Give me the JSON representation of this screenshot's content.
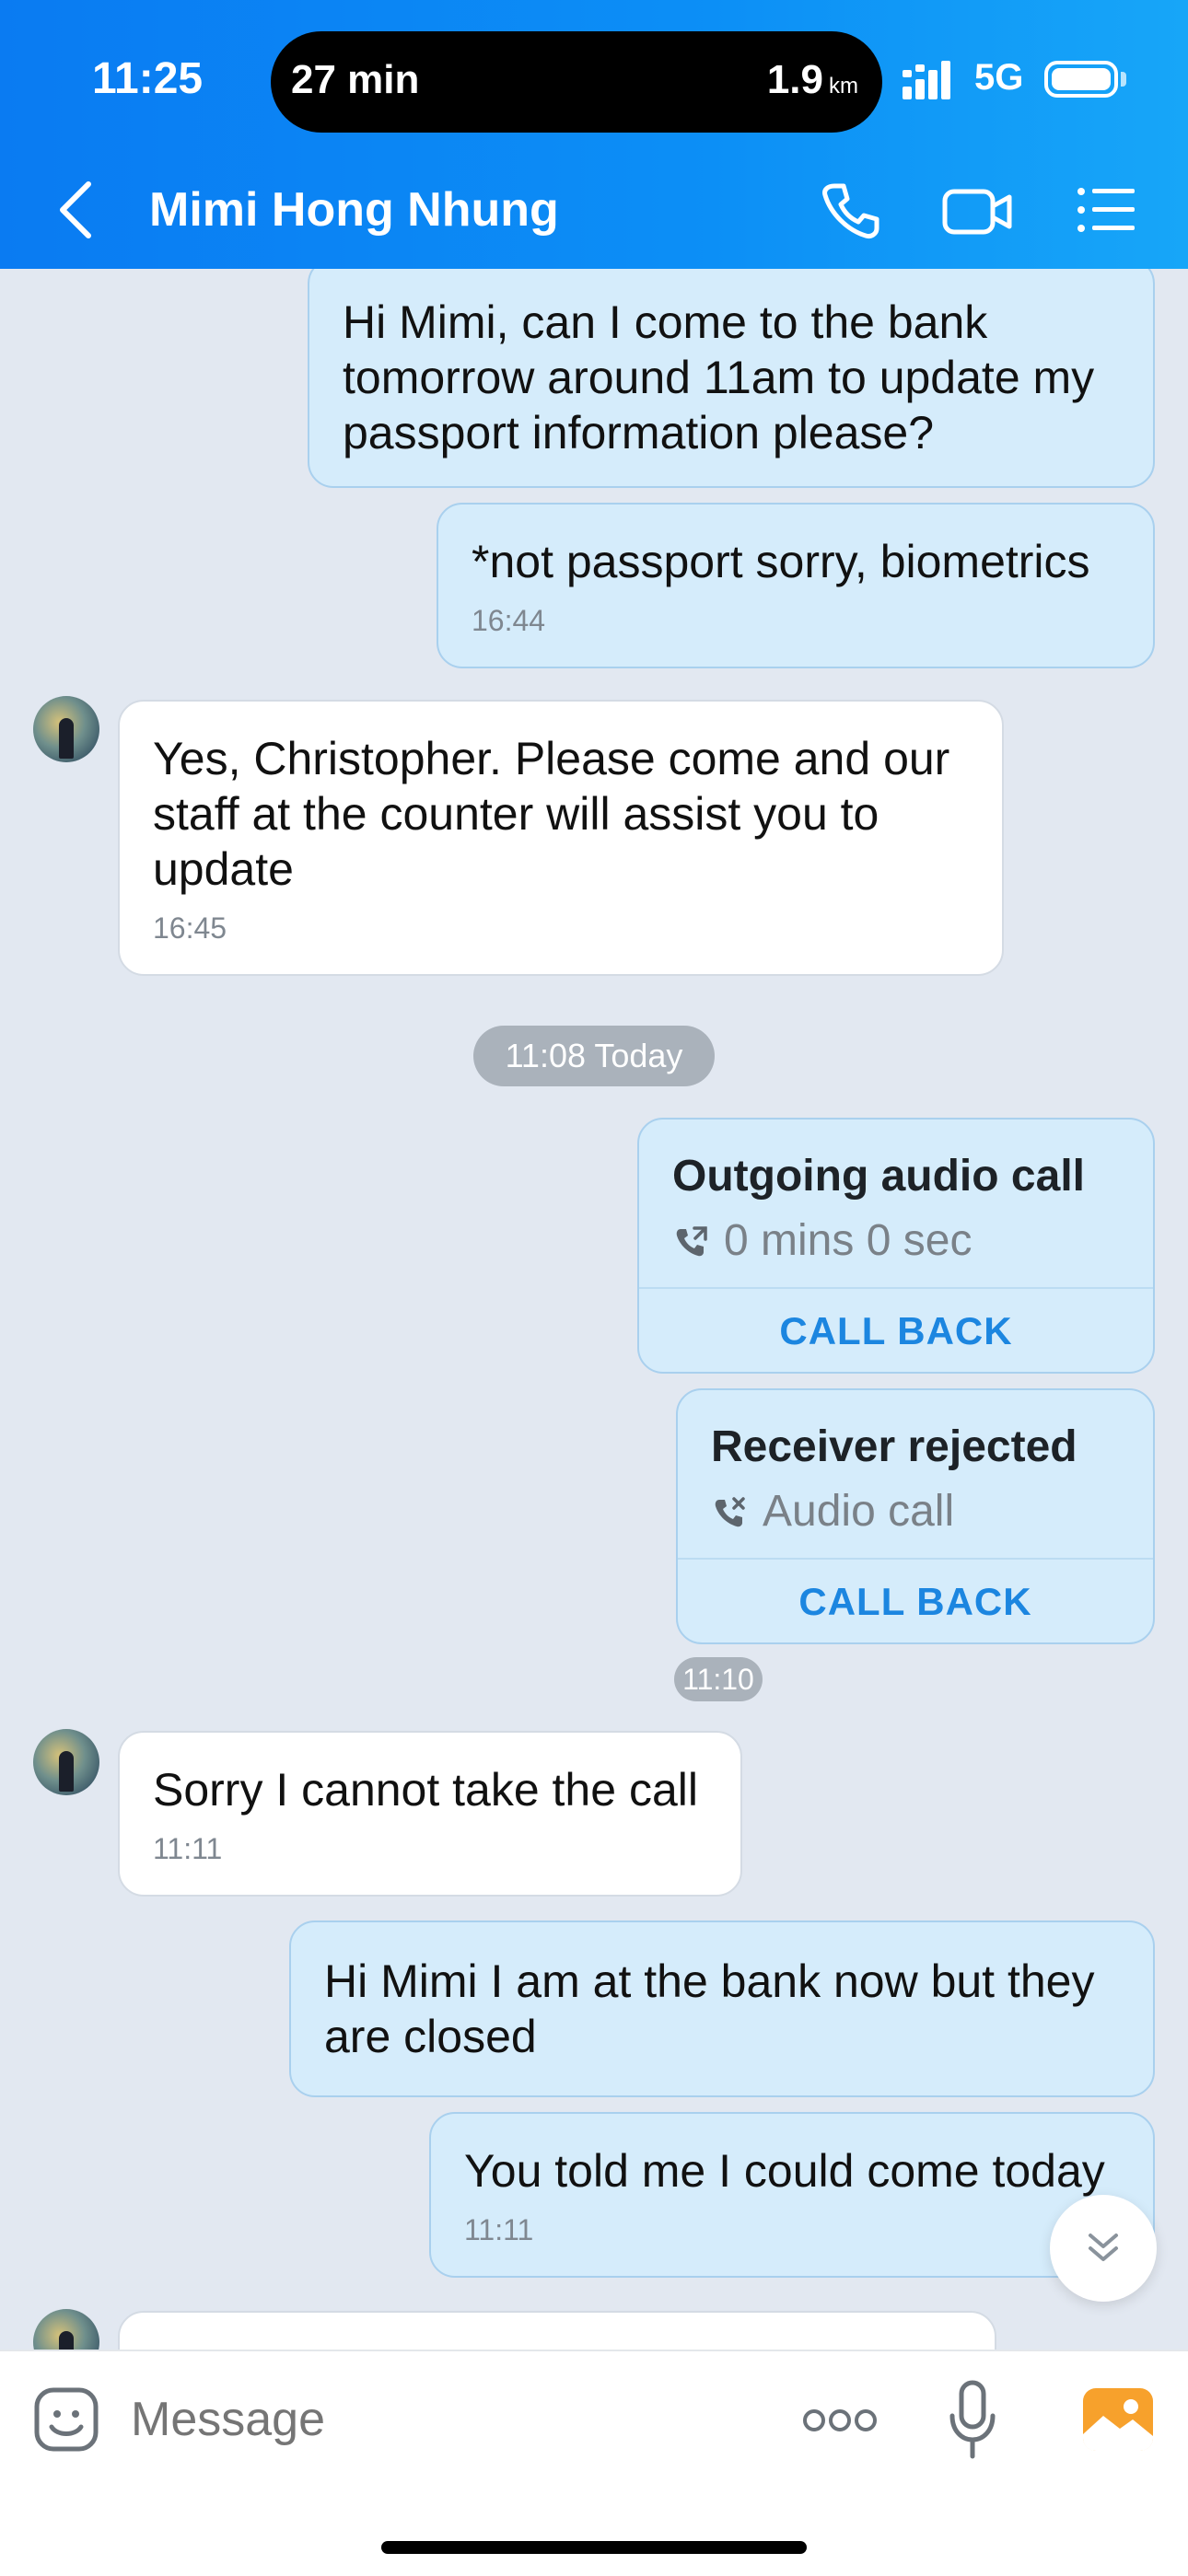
{
  "status_bar": {
    "time": "11:25",
    "island_left": "27 min",
    "island_distance": "1.9",
    "island_unit": "km",
    "network": "5G"
  },
  "header": {
    "contact_name": "Mimi Hong Nhung",
    "icons": [
      "back-icon",
      "phone-icon",
      "video-icon",
      "menu-icon"
    ],
    "background": "#0a7bf2"
  },
  "messages": [
    {
      "direction": "out",
      "text": "Hi Mimi, can I come to the bank tomorrow around 11am to update my passport information please?"
    },
    {
      "direction": "out",
      "text": "*not passport sorry, biometrics",
      "time": "16:44"
    },
    {
      "direction": "in",
      "text": "Yes, Christopher. Please come and our staff at the counter will assist you to update",
      "time": "16:45"
    },
    {
      "type": "date",
      "text": "11:08 Today"
    },
    {
      "type": "call",
      "title": "Outgoing audio call",
      "subtitle": "0 mins 0 sec",
      "action": "CALL BACK",
      "icon": "outgoing-call-icon"
    },
    {
      "type": "call",
      "title": "Receiver rejected",
      "subtitle": "Audio call",
      "action": "CALL BACK",
      "icon": "missed-call-icon"
    },
    {
      "type": "time",
      "text": "11:10"
    },
    {
      "direction": "in",
      "text": "Sorry I cannot take the call",
      "time": "11:11"
    },
    {
      "direction": "out",
      "text": "Hi Mimi I am at the bank now but they are closed"
    },
    {
      "direction": "out",
      "text": "You told me I could come today",
      "time": "11:11"
    }
  ],
  "composer": {
    "placeholder": "Message",
    "icons": [
      "sticker-icon",
      "more-icon",
      "microphone-icon",
      "gallery-icon"
    ]
  },
  "colors": {
    "accent": "#1c86e0",
    "outgoing_bubble": "#d5ecfb",
    "incoming_bubble": "#ffffff",
    "chat_background": "#e2e8f1"
  }
}
